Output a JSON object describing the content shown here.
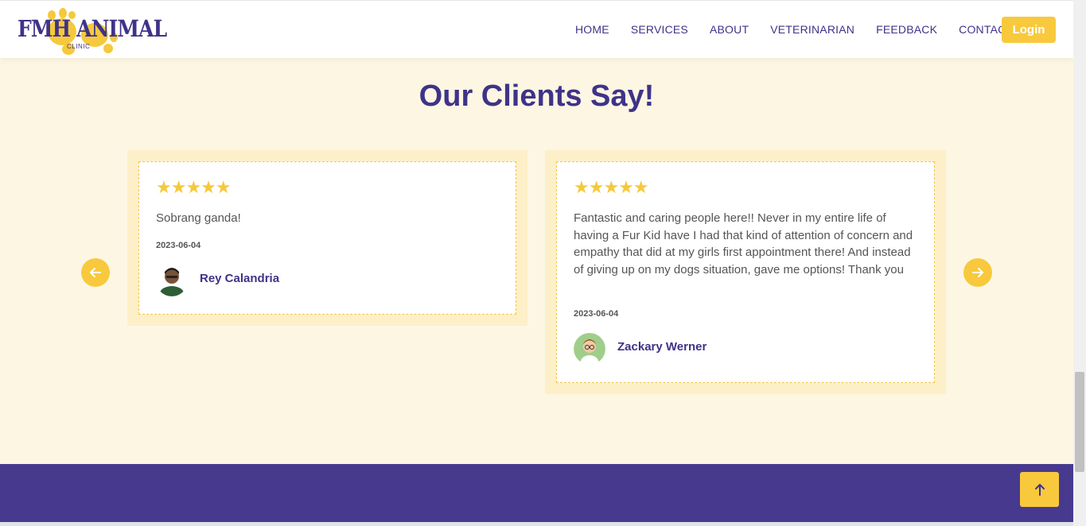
{
  "header": {
    "logo_text": "FMH ANIMAL",
    "logo_sub": "CLINIC",
    "nav": [
      "HOME",
      "SERVICES",
      "ABOUT",
      "VETERINARIAN",
      "FEEDBACK",
      "CONTACT"
    ],
    "login_label": "Login"
  },
  "section": {
    "title": "Our Clients Say!"
  },
  "testimonials": [
    {
      "stars": "★★★★★",
      "text": "Sobrang ganda!",
      "date": "2023-06-04",
      "name": "Rey Calandria"
    },
    {
      "stars": "★★★★★",
      "text": "Fantastic and caring people here!! Never in my entire life of having a Fur Kid have I had that kind of attention of concern and empathy that did at my girls first appointment there! And instead of giving up on my dogs situation, gave me options! Thank you",
      "date": "2023-06-04",
      "name": "Zackary Werner"
    }
  ],
  "colors": {
    "brand": "#3f3388",
    "accent": "#f8c93d",
    "footer": "#473a8e",
    "background": "#fdf6e3"
  },
  "icons": {
    "prev": "arrow-left-icon",
    "next": "arrow-right-icon",
    "top": "arrow-up-icon"
  }
}
